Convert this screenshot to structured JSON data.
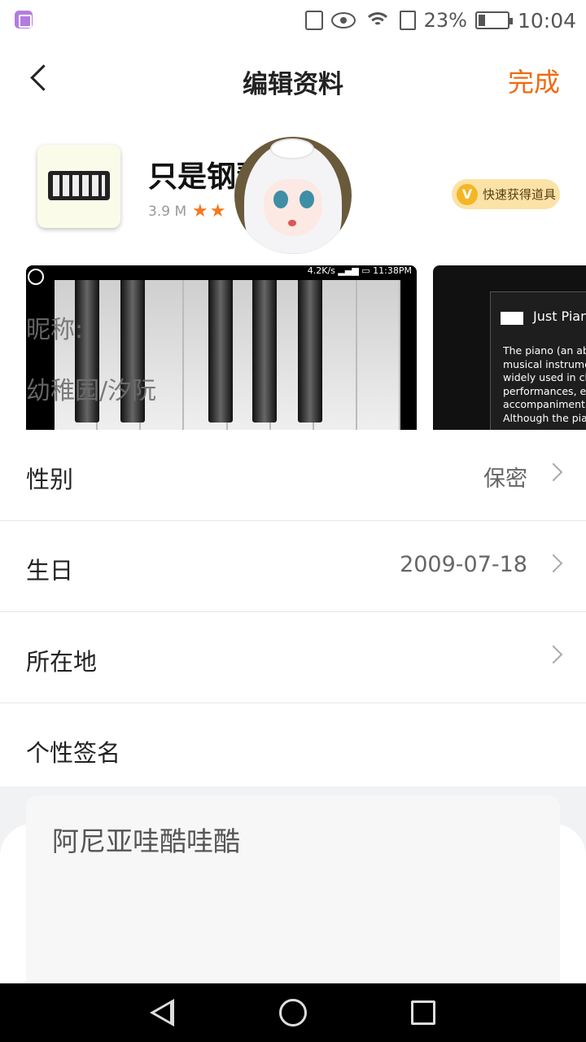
{
  "status_bar": {
    "battery_percent": "23%",
    "time": "10:04",
    "icons": [
      "gallery-icon",
      "vibrate-icon",
      "eye-icon",
      "wifi-icon",
      "sim-icon",
      "battery-icon"
    ]
  },
  "header": {
    "title": "编辑资料",
    "done_label": "完成"
  },
  "app_card": {
    "name": "只是钢琴",
    "size": "3.9 M",
    "stars": "★★",
    "fast_button": "快速获得道具",
    "fast_icon_letter": "V",
    "shot1_status": "4.2K/s  ▂▄▆ ▭ 11:38PM",
    "shot2_title": "Just Piano",
    "shot2_body": "The piano (an ab\nmusical instrume\nwidely used in cla\nperformances, en\naccompaniment,\nAlthough the pian"
  },
  "profile": {
    "nickname_label": "昵称:",
    "nickname_value": "幼稚园/汐阮"
  },
  "settings": [
    {
      "label": "性别",
      "value": "保密"
    },
    {
      "label": "生日",
      "value": "2009-07-18"
    },
    {
      "label": "所在地",
      "value": ""
    },
    {
      "label": "个性签名",
      "value": ""
    }
  ],
  "signature": {
    "text": "阿尼亚哇酷哇酷"
  },
  "colors": {
    "accent": "#f06a10",
    "star": "#f37a1f",
    "badge_bg": "#fbe3a7"
  }
}
